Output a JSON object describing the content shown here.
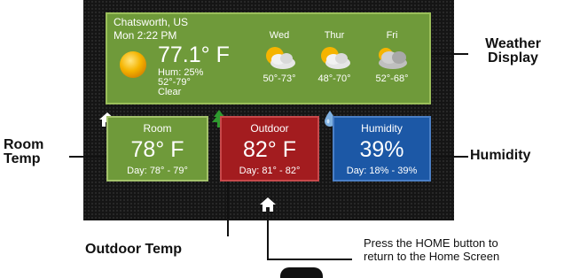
{
  "weather": {
    "location": "Chatsworth, US",
    "datetime": "Mon 2:22 PM",
    "temperature": "77.1° F",
    "humidity": "Hum: 25%",
    "range": "52°-79°",
    "condition": "Clear",
    "current_icon": "sun-icon",
    "forecast": [
      {
        "day": "Wed",
        "range": "50°-73°",
        "icon": "partly-cloudy-icon"
      },
      {
        "day": "Thur",
        "range": "48°-70°",
        "icon": "partly-cloudy-icon"
      },
      {
        "day": "Fri",
        "range": "52°-68°",
        "icon": "cloudy-icon"
      }
    ]
  },
  "tiles": {
    "room": {
      "title": "Room",
      "value": "78° F",
      "range": "Day: 78° - 79°",
      "icon": "home-icon"
    },
    "outdoor": {
      "title": "Outdoor",
      "value": "82° F",
      "range": "Day: 81° - 82°",
      "icon": "tree-icon"
    },
    "humidity": {
      "title": "Humidity",
      "value": "39%",
      "range": "Day: 18% - 39%",
      "icon": "water-drop-icon"
    }
  },
  "callouts": {
    "weather_line1": "Weather",
    "weather_line2": "Display",
    "room_line1": "Room",
    "room_line2": "Temp",
    "humidity": "Humidity",
    "outdoor": "Outdoor Temp",
    "home_line1": "Press the HOME button to",
    "home_line2": "return to the Home Screen"
  },
  "home_button": {
    "icon": "home-icon"
  },
  "colors": {
    "screen_bg": "#151515",
    "weather_green": "#6f9a3a",
    "room_green": "#6f9a3a",
    "outdoor_red": "#a31c1f",
    "humidity_blue": "#1c58a6"
  }
}
